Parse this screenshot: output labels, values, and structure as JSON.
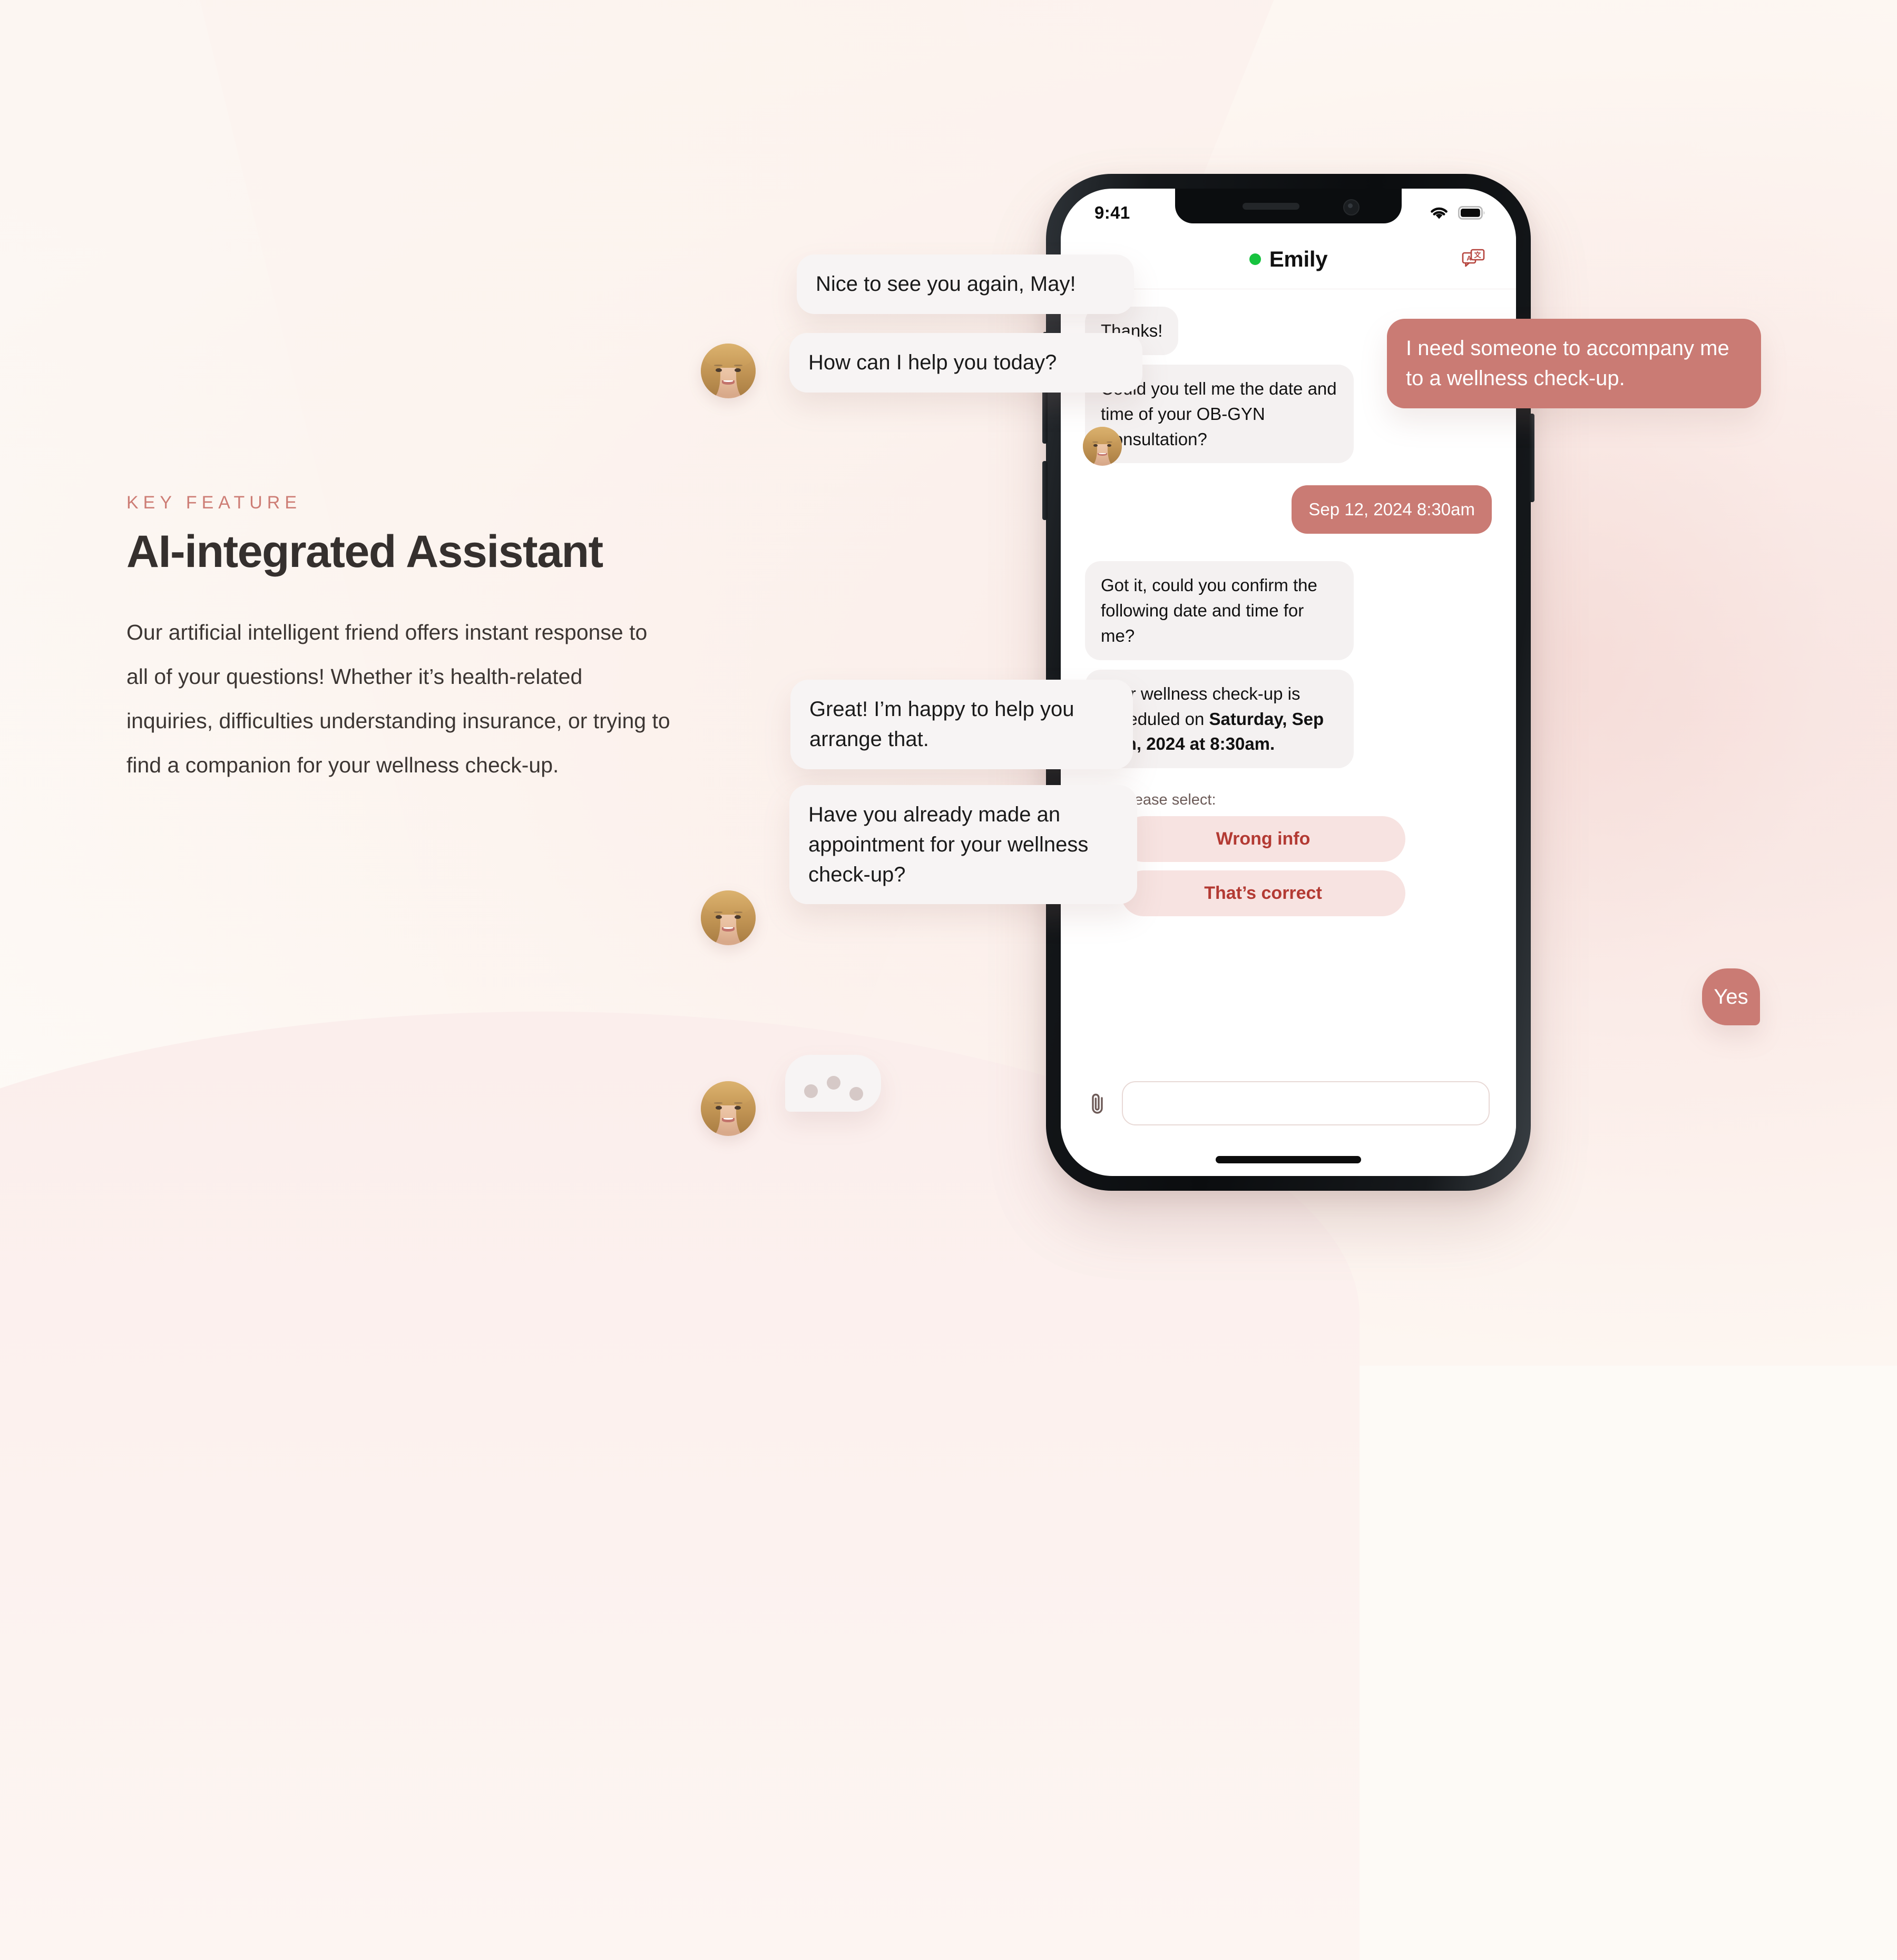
{
  "feature": {
    "eyebrow": "KEY FEATURE",
    "headline": "AI-integrated Assistant",
    "body": "Our artificial intelligent friend offers instant response to all of your questions! Whether it’s health-related inquiries, difficulties understanding insurance, or trying to find  a companion for your wellness check-up."
  },
  "phone": {
    "status_bar": {
      "time": "9:41",
      "wifi_icon": "wifi-icon",
      "battery_icon": "battery-icon"
    },
    "header": {
      "contact_name": "Emily",
      "online_status": "online",
      "translate_icon": "translate-icon"
    },
    "messages": [
      {
        "id": "m-thanks",
        "side": "in",
        "text": "Thanks!"
      },
      {
        "id": "m-date-q",
        "side": "in",
        "text": "Could you tell me the date and time of your OB-GYN Consultation?"
      },
      {
        "id": "m-datetime",
        "side": "out",
        "text": "Sep 12, 2024 8:30am"
      },
      {
        "id": "m-confirm",
        "side": "in",
        "text": "Got it, could you confirm the following date and time for me?"
      },
      {
        "id": "m-sched-a",
        "side": "in",
        "text": "Your wellness check-up is scheduled on ",
        "bold": "Saturday, Sep 12th, 2024 at 8:30am."
      }
    ],
    "select_prompt": "Please select:",
    "choices": [
      {
        "id": "choice-wrong",
        "label": "Wrong info"
      },
      {
        "id": "choice-correct",
        "label": "That’s correct"
      }
    ],
    "composer": {
      "attach_icon": "paperclip-icon",
      "input_value": "",
      "input_placeholder": ""
    }
  },
  "floating": {
    "nice": "Nice to see you again, May!",
    "how": "How can I help you today?",
    "need": "I need someone to accompany me to a wellness check-up.",
    "great": "Great! I’m happy to help you arrange that.",
    "have": "Have you already made an appointment for your wellness check-up?",
    "yes": "Yes",
    "typing": "typing-indicator"
  },
  "colors": {
    "accent": "#ca7b74",
    "accent_dark": "#b33a33",
    "accent_soft": "#f7e3e1",
    "bubble_gray": "#f4f1f1",
    "eyebrow": "#cd7d75",
    "online": "#17c33f",
    "page_bg": "#fdfaf6"
  }
}
